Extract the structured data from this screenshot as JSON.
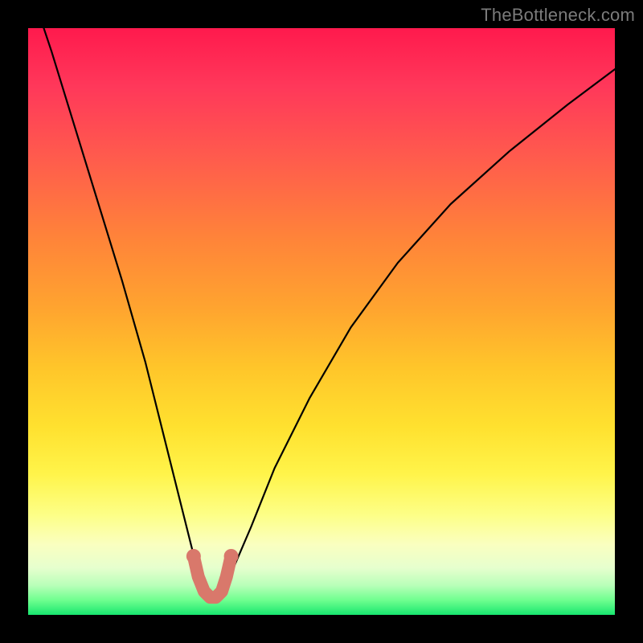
{
  "watermark": "TheBottleneck.com",
  "chart_data": {
    "type": "line",
    "title": "",
    "xlabel": "",
    "ylabel": "",
    "xlim": [
      0,
      100
    ],
    "ylim": [
      0,
      100
    ],
    "series": [
      {
        "name": "bottleneck-curve",
        "x": [
          0,
          4,
          8,
          12,
          16,
          20,
          23,
          26,
          28,
          30,
          31,
          32,
          33,
          35,
          38,
          42,
          48,
          55,
          63,
          72,
          82,
          92,
          100
        ],
        "values": [
          108,
          96,
          83,
          70,
          57,
          43,
          31,
          19,
          11,
          5,
          3,
          3,
          4,
          8,
          15,
          25,
          37,
          49,
          60,
          70,
          79,
          87,
          93
        ]
      }
    ],
    "highlight": {
      "name": "optimal-range",
      "x": [
        28.2,
        29.0,
        30.0,
        31.0,
        32.0,
        33.0,
        33.8,
        34.6
      ],
      "values": [
        10.0,
        6.5,
        4.0,
        3.0,
        3.0,
        4.0,
        6.5,
        10.0
      ]
    },
    "background_gradient": {
      "top": "#ff1a4d",
      "mid": "#ffe12f",
      "bottom": "#18e66f"
    }
  }
}
